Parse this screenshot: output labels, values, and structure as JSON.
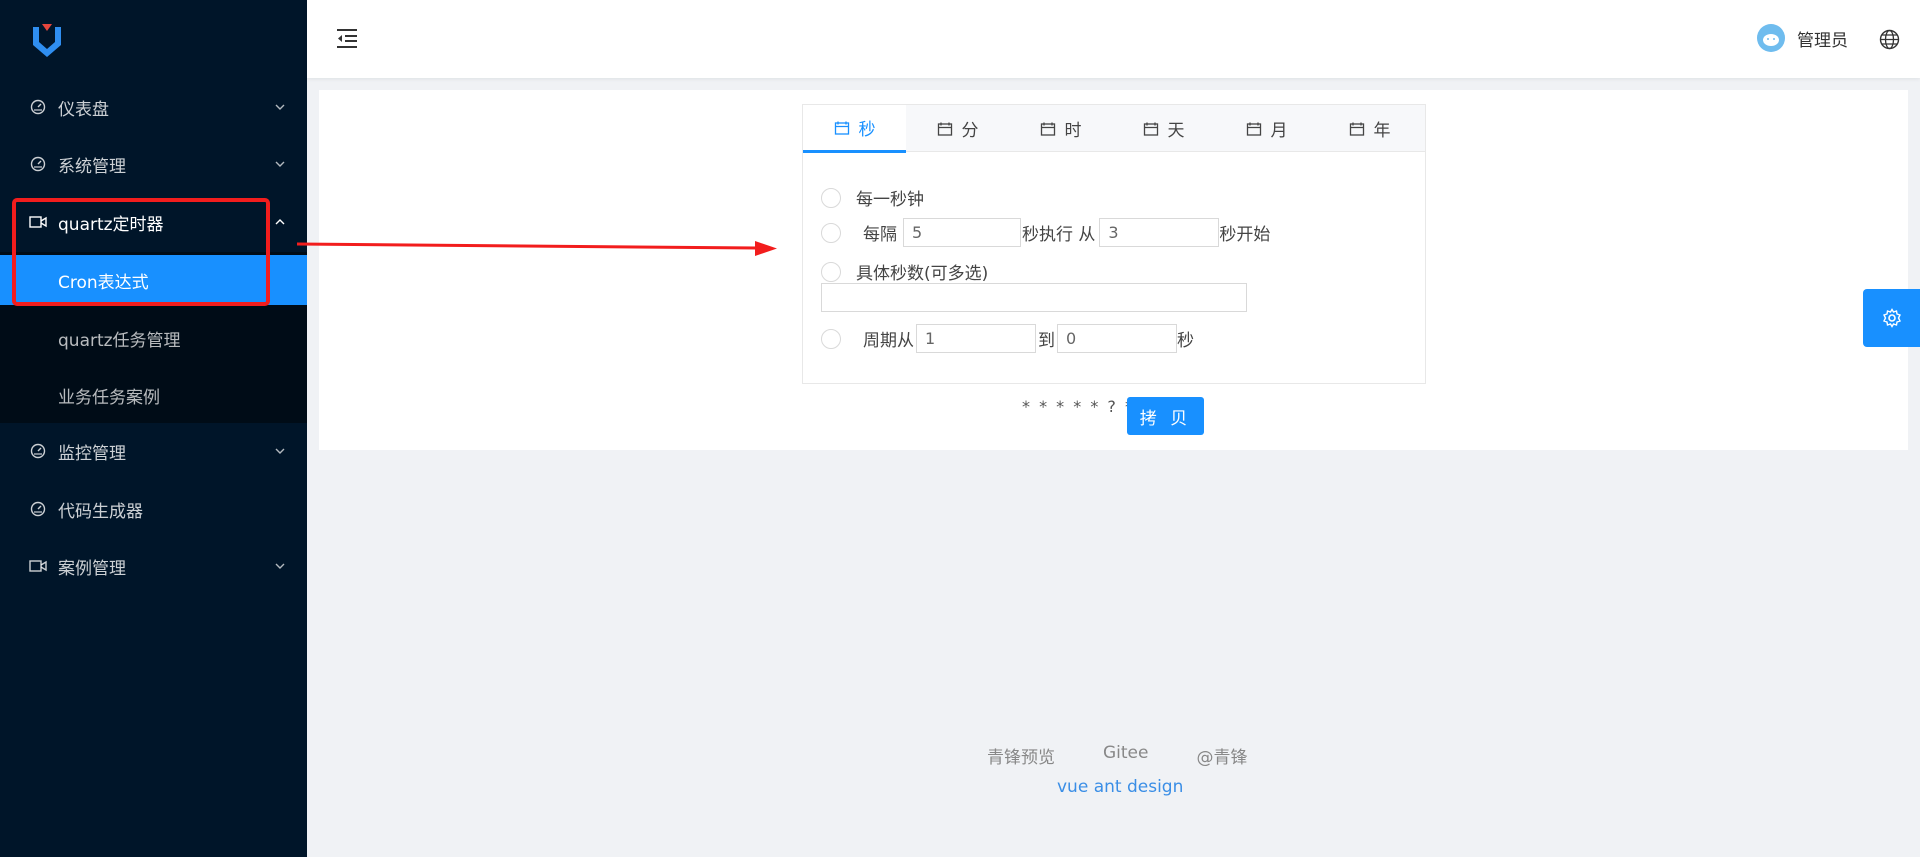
{
  "sidebar": {
    "items": [
      {
        "label": "仪表盘"
      },
      {
        "label": "系统管理"
      },
      {
        "label": "quartz定时器"
      },
      {
        "label": "监控管理"
      },
      {
        "label": "代码生成器"
      },
      {
        "label": "案例管理"
      }
    ],
    "submenu": [
      {
        "label": "Cron表达式"
      },
      {
        "label": "quartz任务管理"
      },
      {
        "label": "业务任务案例"
      }
    ]
  },
  "header": {
    "user_name": "管理员"
  },
  "cron": {
    "tabs": [
      {
        "label": "秒"
      },
      {
        "label": "分"
      },
      {
        "label": "时"
      },
      {
        "label": "天"
      },
      {
        "label": "月"
      },
      {
        "label": "年"
      }
    ],
    "every_label": "每一秒钟",
    "interval_prefix": "每隔",
    "interval_value": "5",
    "interval_mid": "秒执行 从",
    "interval_start": "3",
    "interval_suffix": "秒开始",
    "specific_label": "具体秒数(可多选)",
    "range_prefix": "周期从",
    "range_from": "1",
    "range_mid": "到",
    "range_to": "0",
    "range_suffix": "秒",
    "expression": "* * * * * ? *",
    "copy_label": "拷 贝"
  },
  "footer": {
    "links": [
      "青锋预览",
      "Gitee",
      "@青锋"
    ],
    "sub": "vue ant design"
  },
  "colors": {
    "sidebar_bg": "#001529",
    "accent": "#1890ff",
    "annotation": "#f21d1d"
  }
}
